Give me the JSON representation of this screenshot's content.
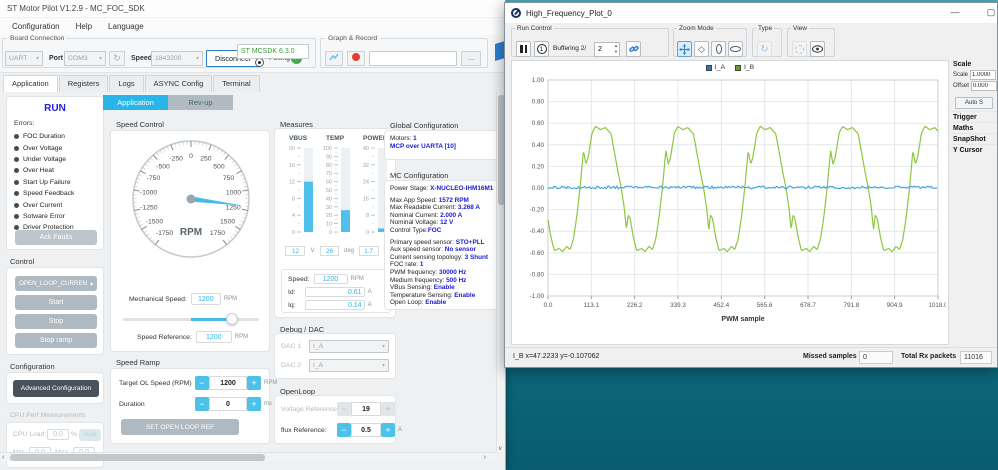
{
  "main_window": {
    "title": "ST Motor Pilot V1.2.9 - MC_FOC_SDK",
    "menus": [
      "Configuration",
      "Help",
      "Language"
    ],
    "connection": {
      "group_label": "Board Connection",
      "interface_value": "UART",
      "port_label": "Port",
      "port_value": "COM3",
      "speed_label": "Speed",
      "speed_value": "1843200",
      "disconnect_label": "Disconnect",
      "polling_label": "Polling",
      "firmware_value": "ST MCSDK 6.3.0"
    },
    "graph_record": {
      "group_label": "Graph & Record",
      "browse_label": "..."
    },
    "tabs": [
      "Application",
      "Registers",
      "Logs",
      "ASYNC Config",
      "Terminal"
    ],
    "active_tab": "Application",
    "sidebar": {
      "run_label": "RUN",
      "errors_label": "Errors:",
      "errors": [
        "FOC Duration",
        "Over Voltage",
        "Under Voltage",
        "Over Heat",
        "Start Up Failure",
        "Speed Feedback",
        "Over Current",
        "Sotware Error",
        "Driver Protection"
      ],
      "ack_faults_label": "Ack Faults",
      "control_label": "Control",
      "control_mode": "OPEN_LOOP_CURREN",
      "start_label": "Start",
      "stop_label": "Stop",
      "stop_ramp_label": "Stop ramp",
      "configuration_label": "Configuration",
      "advanced_config_label": "Advanced Configuration",
      "cpu_perf_label": "CPU Perf Measurements",
      "cpu_load_label": "CPU Load:",
      "cpu_load_value": "0.0",
      "cpu_load_unit": "%",
      "reset_label": "reset",
      "min_label": "Min:",
      "min_value": "0.0",
      "max_label": "Max:",
      "max_value": "0.0"
    },
    "subtabs": {
      "application": "Application",
      "revup": "Rev-up"
    },
    "speed_control": {
      "title": "Speed Control",
      "gauge_unit": "RPM",
      "gauge_ticks": [
        -1750,
        -1500,
        -1250,
        -1000,
        -750,
        -500,
        -250,
        0,
        250,
        500,
        750,
        1000,
        1250,
        1500,
        1750
      ],
      "gauge_value": 1200,
      "mech_speed_label": "Mechanical Speed:",
      "mech_speed_value": "1200",
      "mech_speed_unit": "RPM",
      "speed_ref_label": "Speed Reference:",
      "speed_ref_value": "1200",
      "speed_ref_unit": "RPM",
      "slider_fill_start_pct": 50,
      "slider_knob_pct": 80
    },
    "speed_ramp": {
      "title": "Speed Ramp",
      "target_label": "Target OL Speed (RPM)",
      "target_value": "1200",
      "target_unit": "RPM",
      "duration_label": "Duration",
      "duration_value": "0",
      "duration_unit": "ms",
      "set_button": "SET OPEN LOOP REF"
    },
    "measures": {
      "title": "Measures",
      "gauges": [
        {
          "label": "VBUS",
          "min": 0,
          "max": 20,
          "step": 4,
          "value": 12,
          "display": "12",
          "unit": "V"
        },
        {
          "label": "TEMP",
          "min": 0,
          "max": 100,
          "step": 10,
          "value": 26,
          "display": "26",
          "unit": "deg"
        },
        {
          "label": "POWER",
          "min": 0,
          "max": 40,
          "step": 8,
          "value": 1.7,
          "display": "1.7",
          "unit": "W"
        }
      ],
      "speed_label": "Speed:",
      "speed_value": "1200",
      "speed_unit": "RPM",
      "id_label": "Id:",
      "id_value": "0.61",
      "id_unit": "A",
      "iq_label": "Iq:",
      "iq_value": "0.14",
      "iq_unit": "A"
    },
    "debug_dac": {
      "title": "Debug / DAC",
      "dac1_label": "DAC 1",
      "dac1_value": "I_A",
      "dac2_label": "DAC 2",
      "dac2_value": "I_A"
    },
    "openloop": {
      "title": "OpenLoop",
      "voltage_label": "Voltage Reference:",
      "voltage_value": "19",
      "flux_label": "flux Reference:",
      "flux_value": "0.5",
      "flux_unit": "A"
    },
    "global_config": {
      "title": "Global Configuration",
      "lines": [
        {
          "label": "Motors: ",
          "value": "1"
        },
        {
          "label": "",
          "value": "MCP over UARTA [10]"
        }
      ],
      "mc_title": "MC Configuration",
      "mc_groups": [
        [
          {
            "label": "Power Stage: ",
            "value": "X-NUCLEO-IHM16M1"
          }
        ],
        [
          {
            "label": "Max App Speed: ",
            "value": "1572 RPM"
          },
          {
            "label": "Max Readable Current: ",
            "value": "3.268 A"
          },
          {
            "label": "Nominal Current: ",
            "value": "2.000 A"
          },
          {
            "label": "Nominal Voltage: ",
            "value": "12 V"
          },
          {
            "label": "Control Type:",
            "value": "FOC"
          }
        ],
        [
          {
            "label": "Primary speed sensor: ",
            "value": "STO+PLL"
          },
          {
            "label": "Aux speed sensor: ",
            "value": "No sensor"
          },
          {
            "label": "Current sensing topology: ",
            "value": "3 Shunt"
          },
          {
            "label": "FOC rate: ",
            "value": "1"
          },
          {
            "label": "PWM frequency: ",
            "value": "30000 Hz"
          },
          {
            "label": "Medium frequency: ",
            "value": "500 Hz"
          },
          {
            "label": "VBus Sensing: ",
            "value": "Enable"
          },
          {
            "label": "Temperature Sensing: ",
            "value": "Enable"
          },
          {
            "label": "Open Loop: ",
            "value": "Enable"
          }
        ]
      ]
    }
  },
  "plot_window": {
    "title": "High_Frequency_Plot_0",
    "toolbar": {
      "run_control_label": "Run Control",
      "buffering_label": "Buffering 2/",
      "buffering_value": "2",
      "zoom_mode_label": "Zoom Mode",
      "type_label": "Type",
      "view_label": "View"
    },
    "status": {
      "cursor": "I_B x=47.2233 y=-0.107062",
      "missed_label": "Missed samples",
      "missed_value": "0",
      "rx_label": "Total Rx packets",
      "rx_value": "11016"
    },
    "side_panel": {
      "scale_header": "Scale",
      "scale_label": "Scale",
      "scale_value": "1.0000",
      "offset_label": "Offset",
      "offset_value": "0.000",
      "autoscale_label": "Auto S",
      "sections": [
        "Trigger",
        "Maths",
        "SnapShot",
        "Y Cursor"
      ]
    }
  },
  "chart_data": {
    "type": "line",
    "title": "",
    "xlabel": "PWM sample",
    "ylabel": "",
    "xlim": [
      0,
      1018
    ],
    "ylim": [
      -1.0,
      1.0
    ],
    "x_ticks": [
      0.0,
      113.1,
      226.2,
      339.3,
      452.4,
      565.6,
      678.7,
      791.8,
      904.9,
      1018.0
    ],
    "y_ticks": [
      -1.0,
      -0.8,
      -0.6,
      -0.4,
      -0.2,
      0.0,
      0.2,
      0.4,
      0.6,
      0.8,
      1.0
    ],
    "grid": true,
    "legend_position": "top-center",
    "legend": [
      {
        "name": "I_A",
        "color": "#2e75b6"
      },
      {
        "name": "I_B",
        "color": "#6a9a28"
      }
    ],
    "series": [
      {
        "name": "I_A",
        "color": "#41a3db",
        "description": "flat noise around zero",
        "baseline": 0.005,
        "noise": 0.013
      },
      {
        "name": "I_B",
        "color": "#8dc63f",
        "description": "distorted sinusoid, period ~215 PWM samples, first peak at x~124, max ~0.57, min ~ -0.60",
        "period": 215,
        "peak_x": 124,
        "cycle_shape": [
          [
            0.0,
            0.57
          ],
          [
            0.06,
            0.54
          ],
          [
            0.12,
            0.56
          ],
          [
            0.19,
            0.5
          ],
          [
            0.23,
            0.33
          ],
          [
            0.27,
            0.16
          ],
          [
            0.3125,
            0.0
          ],
          [
            0.35,
            -0.19
          ],
          [
            0.375,
            -0.39
          ],
          [
            0.396,
            -0.25
          ],
          [
            0.42,
            -0.28
          ],
          [
            0.458,
            -0.45
          ],
          [
            0.5,
            -0.58
          ],
          [
            0.56,
            -0.56
          ],
          [
            0.6,
            -0.59
          ],
          [
            0.65,
            -0.54
          ],
          [
            0.69,
            -0.57
          ],
          [
            0.73,
            -0.48
          ],
          [
            0.77,
            -0.28
          ],
          [
            0.8125,
            0.0
          ],
          [
            0.854,
            0.35
          ],
          [
            0.883,
            0.22
          ],
          [
            0.91,
            0.28
          ],
          [
            0.958,
            0.51
          ],
          [
            1.0,
            0.57
          ]
        ]
      }
    ]
  }
}
